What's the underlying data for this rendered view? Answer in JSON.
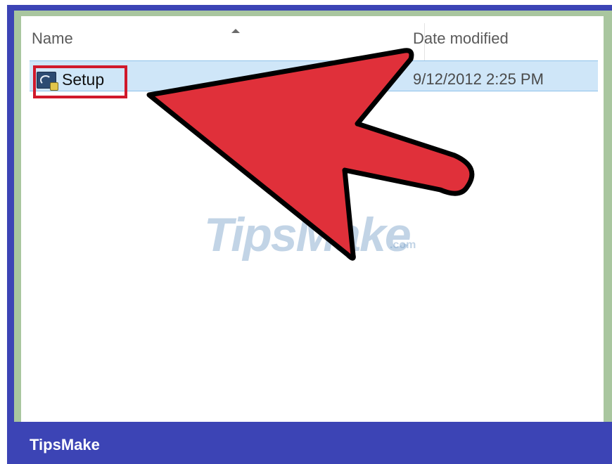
{
  "explorer": {
    "columns": {
      "name_label": "Name",
      "date_label": "Date modified"
    },
    "files": [
      {
        "name": "Setup",
        "date_modified": "9/12/2012 2:25 PM",
        "icon": "setup-installer-icon"
      }
    ]
  },
  "watermark": {
    "text": "TipsMake",
    "suffix": ".com"
  },
  "footer": {
    "brand": "TipsMake"
  },
  "colors": {
    "border_blue": "#3c44b5",
    "highlight_red": "#d0192b",
    "arrow_red": "#e0303a",
    "row_selected": "#cfe6f8"
  }
}
